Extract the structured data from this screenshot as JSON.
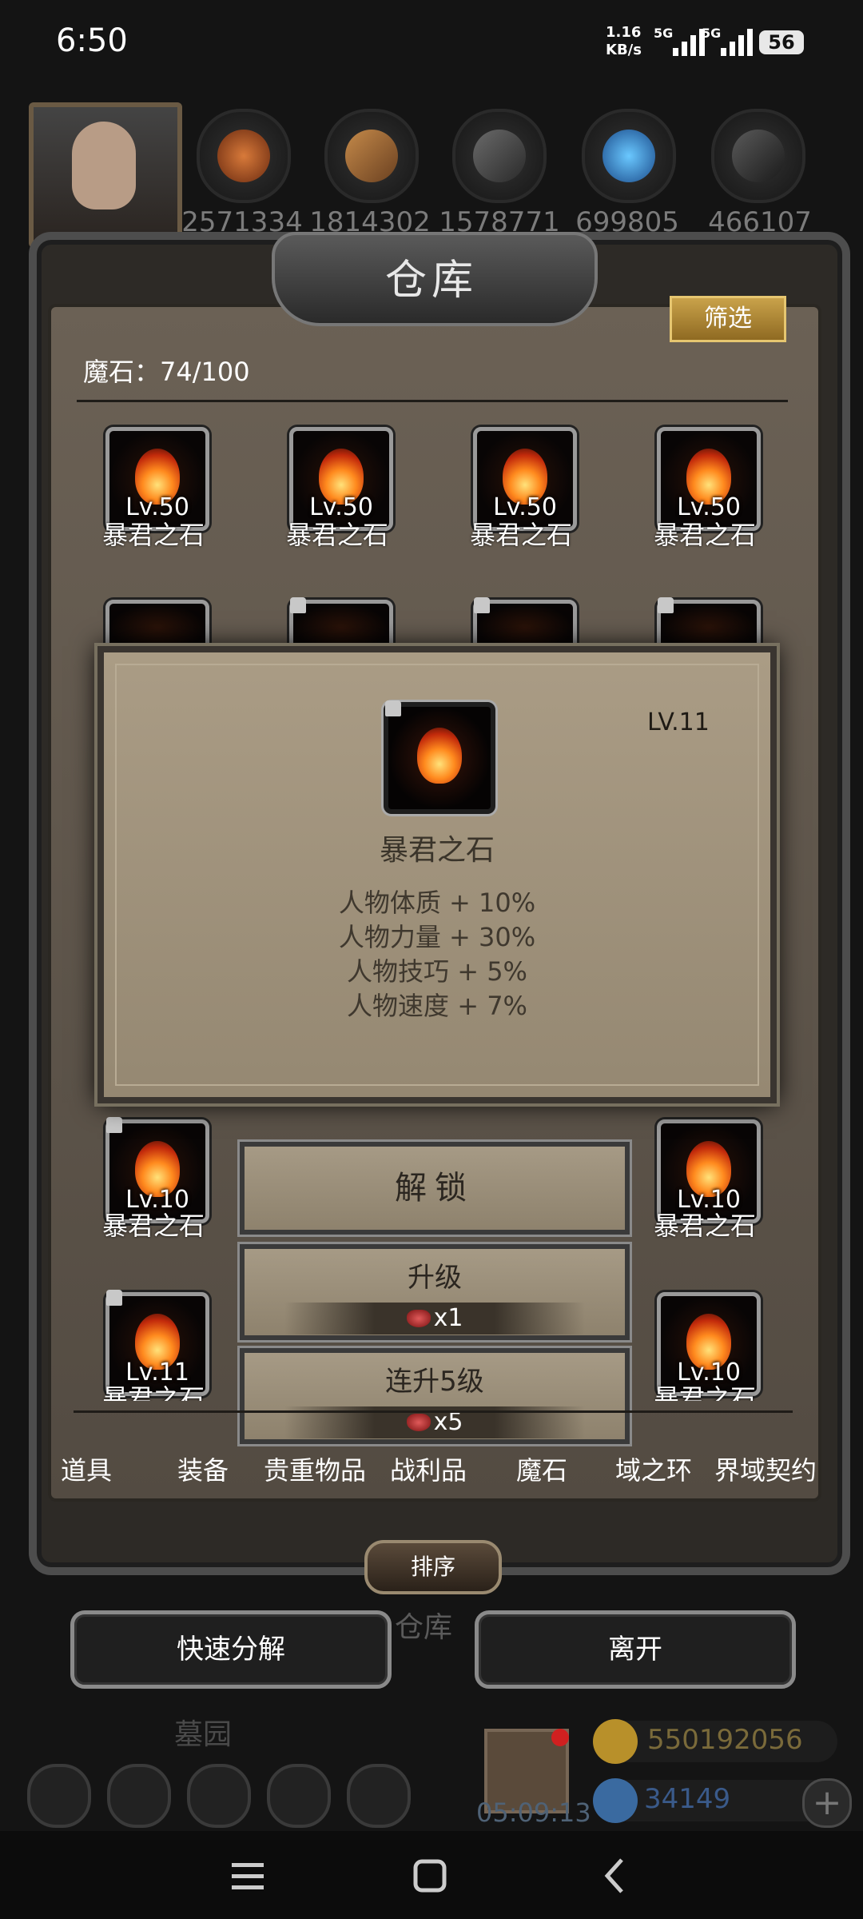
{
  "status_bar": {
    "time": "6:50",
    "net_speed_value": "1.16",
    "net_speed_unit": "KB/s",
    "signal_1": "5G",
    "signal_2": "5G",
    "battery": "56"
  },
  "resources": {
    "values": [
      "2571334",
      "1814302",
      "1578771",
      "699805",
      "466107"
    ],
    "icons": [
      "meat-icon",
      "wood-icon",
      "iron-icon",
      "crystal-icon",
      "stone-icon"
    ]
  },
  "warehouse": {
    "title": "仓库",
    "filter_label": "筛选",
    "capacity_label": "魔石：74/100",
    "item_name": "暴君之石",
    "row1_levels": [
      "Lv.50",
      "Lv.50",
      "Lv.50",
      "Lv.50"
    ],
    "row_lower1": {
      "levels": [
        "Lv.10",
        "Lv.10"
      ],
      "names": [
        "暴君之石",
        "暴君之石"
      ]
    },
    "row_lower2": {
      "levels": [
        "Lv.11",
        "Lv.10"
      ],
      "names": [
        "暴君之石",
        "暴君之石"
      ]
    }
  },
  "detail": {
    "level": "LV.11",
    "name": "暴君之石",
    "stats": [
      "人物体质 + 10%",
      "人物力量 + 30%",
      "人物技巧 + 5%",
      "人物速度 + 7%"
    ]
  },
  "actions": {
    "unlock_label": "解锁",
    "upgrade_label": "升级",
    "upgrade_cost": "x1",
    "upgrade5_label": "连升5级",
    "upgrade5_cost": "x5"
  },
  "tabs": [
    "道具",
    "装备",
    "贵重物品",
    "战利品",
    "魔石",
    "域之环",
    "界域契约"
  ],
  "sort_label": "排序",
  "bottom_buttons": {
    "decompose": "快速分解",
    "leave": "离开"
  },
  "background": {
    "warehouse_label": "仓库",
    "graveyard_label": "墓园",
    "timer": "05:09:13",
    "gold": "550192056",
    "gems": "34149",
    "plus": "+"
  },
  "colors": {
    "accent_gold": "#c9a24a",
    "panel": "#534b42",
    "popup": "#aa9c85"
  }
}
